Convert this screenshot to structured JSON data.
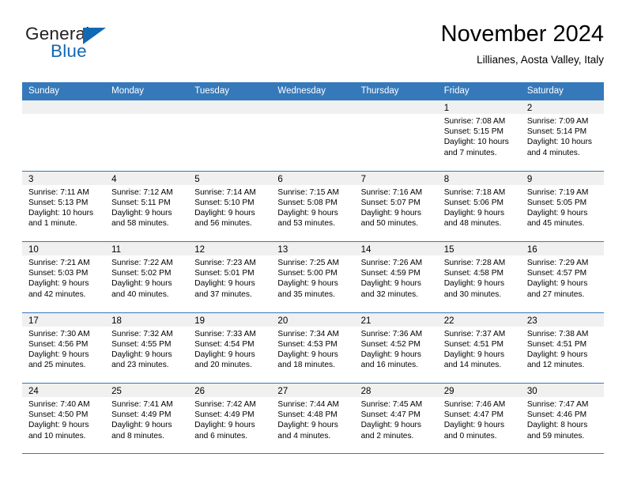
{
  "brand": {
    "name_part1": "General",
    "name_part2": "Blue",
    "triangle_icon": "blue-triangle-icon",
    "colors": {
      "general": "#231f20",
      "blue": "#1268b3"
    }
  },
  "header": {
    "title": "November 2024",
    "subtitle": "Lillianes, Aosta Valley, Italy"
  },
  "theme": {
    "header_bg": "#3679ba",
    "header_text": "#ffffff",
    "day_band_bg": "#f0f0f0",
    "grid_line": "#3679ba",
    "page_bg": "#ffffff"
  },
  "weekdays": [
    "Sunday",
    "Monday",
    "Tuesday",
    "Wednesday",
    "Thursday",
    "Friday",
    "Saturday"
  ],
  "weeks": [
    [
      {
        "day": "",
        "empty": true
      },
      {
        "day": "",
        "empty": true
      },
      {
        "day": "",
        "empty": true
      },
      {
        "day": "",
        "empty": true
      },
      {
        "day": "",
        "empty": true
      },
      {
        "day": "1",
        "sunrise": "Sunrise: 7:08 AM",
        "sunset": "Sunset: 5:15 PM",
        "daylight": "Daylight: 10 hours and 7 minutes."
      },
      {
        "day": "2",
        "sunrise": "Sunrise: 7:09 AM",
        "sunset": "Sunset: 5:14 PM",
        "daylight": "Daylight: 10 hours and 4 minutes."
      }
    ],
    [
      {
        "day": "3",
        "sunrise": "Sunrise: 7:11 AM",
        "sunset": "Sunset: 5:13 PM",
        "daylight": "Daylight: 10 hours and 1 minute."
      },
      {
        "day": "4",
        "sunrise": "Sunrise: 7:12 AM",
        "sunset": "Sunset: 5:11 PM",
        "daylight": "Daylight: 9 hours and 58 minutes."
      },
      {
        "day": "5",
        "sunrise": "Sunrise: 7:14 AM",
        "sunset": "Sunset: 5:10 PM",
        "daylight": "Daylight: 9 hours and 56 minutes."
      },
      {
        "day": "6",
        "sunrise": "Sunrise: 7:15 AM",
        "sunset": "Sunset: 5:08 PM",
        "daylight": "Daylight: 9 hours and 53 minutes."
      },
      {
        "day": "7",
        "sunrise": "Sunrise: 7:16 AM",
        "sunset": "Sunset: 5:07 PM",
        "daylight": "Daylight: 9 hours and 50 minutes."
      },
      {
        "day": "8",
        "sunrise": "Sunrise: 7:18 AM",
        "sunset": "Sunset: 5:06 PM",
        "daylight": "Daylight: 9 hours and 48 minutes."
      },
      {
        "day": "9",
        "sunrise": "Sunrise: 7:19 AM",
        "sunset": "Sunset: 5:05 PM",
        "daylight": "Daylight: 9 hours and 45 minutes."
      }
    ],
    [
      {
        "day": "10",
        "sunrise": "Sunrise: 7:21 AM",
        "sunset": "Sunset: 5:03 PM",
        "daylight": "Daylight: 9 hours and 42 minutes."
      },
      {
        "day": "11",
        "sunrise": "Sunrise: 7:22 AM",
        "sunset": "Sunset: 5:02 PM",
        "daylight": "Daylight: 9 hours and 40 minutes."
      },
      {
        "day": "12",
        "sunrise": "Sunrise: 7:23 AM",
        "sunset": "Sunset: 5:01 PM",
        "daylight": "Daylight: 9 hours and 37 minutes."
      },
      {
        "day": "13",
        "sunrise": "Sunrise: 7:25 AM",
        "sunset": "Sunset: 5:00 PM",
        "daylight": "Daylight: 9 hours and 35 minutes."
      },
      {
        "day": "14",
        "sunrise": "Sunrise: 7:26 AM",
        "sunset": "Sunset: 4:59 PM",
        "daylight": "Daylight: 9 hours and 32 minutes."
      },
      {
        "day": "15",
        "sunrise": "Sunrise: 7:28 AM",
        "sunset": "Sunset: 4:58 PM",
        "daylight": "Daylight: 9 hours and 30 minutes."
      },
      {
        "day": "16",
        "sunrise": "Sunrise: 7:29 AM",
        "sunset": "Sunset: 4:57 PM",
        "daylight": "Daylight: 9 hours and 27 minutes."
      }
    ],
    [
      {
        "day": "17",
        "sunrise": "Sunrise: 7:30 AM",
        "sunset": "Sunset: 4:56 PM",
        "daylight": "Daylight: 9 hours and 25 minutes."
      },
      {
        "day": "18",
        "sunrise": "Sunrise: 7:32 AM",
        "sunset": "Sunset: 4:55 PM",
        "daylight": "Daylight: 9 hours and 23 minutes."
      },
      {
        "day": "19",
        "sunrise": "Sunrise: 7:33 AM",
        "sunset": "Sunset: 4:54 PM",
        "daylight": "Daylight: 9 hours and 20 minutes."
      },
      {
        "day": "20",
        "sunrise": "Sunrise: 7:34 AM",
        "sunset": "Sunset: 4:53 PM",
        "daylight": "Daylight: 9 hours and 18 minutes."
      },
      {
        "day": "21",
        "sunrise": "Sunrise: 7:36 AM",
        "sunset": "Sunset: 4:52 PM",
        "daylight": "Daylight: 9 hours and 16 minutes."
      },
      {
        "day": "22",
        "sunrise": "Sunrise: 7:37 AM",
        "sunset": "Sunset: 4:51 PM",
        "daylight": "Daylight: 9 hours and 14 minutes."
      },
      {
        "day": "23",
        "sunrise": "Sunrise: 7:38 AM",
        "sunset": "Sunset: 4:51 PM",
        "daylight": "Daylight: 9 hours and 12 minutes."
      }
    ],
    [
      {
        "day": "24",
        "sunrise": "Sunrise: 7:40 AM",
        "sunset": "Sunset: 4:50 PM",
        "daylight": "Daylight: 9 hours and 10 minutes."
      },
      {
        "day": "25",
        "sunrise": "Sunrise: 7:41 AM",
        "sunset": "Sunset: 4:49 PM",
        "daylight": "Daylight: 9 hours and 8 minutes."
      },
      {
        "day": "26",
        "sunrise": "Sunrise: 7:42 AM",
        "sunset": "Sunset: 4:49 PM",
        "daylight": "Daylight: 9 hours and 6 minutes."
      },
      {
        "day": "27",
        "sunrise": "Sunrise: 7:44 AM",
        "sunset": "Sunset: 4:48 PM",
        "daylight": "Daylight: 9 hours and 4 minutes."
      },
      {
        "day": "28",
        "sunrise": "Sunrise: 7:45 AM",
        "sunset": "Sunset: 4:47 PM",
        "daylight": "Daylight: 9 hours and 2 minutes."
      },
      {
        "day": "29",
        "sunrise": "Sunrise: 7:46 AM",
        "sunset": "Sunset: 4:47 PM",
        "daylight": "Daylight: 9 hours and 0 minutes."
      },
      {
        "day": "30",
        "sunrise": "Sunrise: 7:47 AM",
        "sunset": "Sunset: 4:46 PM",
        "daylight": "Daylight: 8 hours and 59 minutes."
      }
    ]
  ]
}
